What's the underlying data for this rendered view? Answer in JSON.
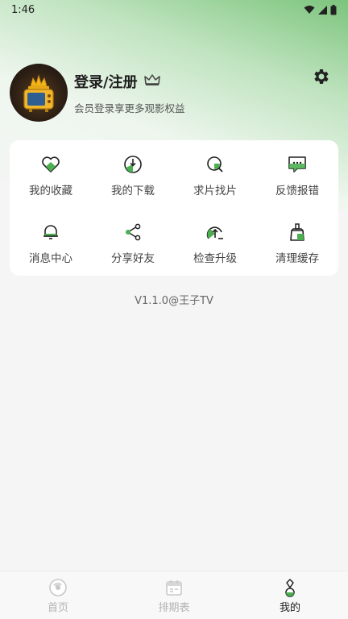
{
  "status_bar": {
    "time": "1:46"
  },
  "profile": {
    "login_label": "登录/注册",
    "member_subtitle": "会员登录享更多观影权益"
  },
  "grid": [
    {
      "label": "我的收藏",
      "icon": "heart-icon"
    },
    {
      "label": "我的下载",
      "icon": "download-icon"
    },
    {
      "label": "求片找片",
      "icon": "search-film-icon"
    },
    {
      "label": "反馈报错",
      "icon": "feedback-icon"
    },
    {
      "label": "消息中心",
      "icon": "bell-icon"
    },
    {
      "label": "分享好友",
      "icon": "share-icon"
    },
    {
      "label": "检查升级",
      "icon": "upgrade-icon"
    },
    {
      "label": "清理缓存",
      "icon": "clean-cache-icon"
    }
  ],
  "version": "V1.1.0@王子TV",
  "bottom_nav": [
    {
      "label": "首页",
      "icon": "home-icon",
      "active": false
    },
    {
      "label": "排期表",
      "icon": "calendar-icon",
      "active": false
    },
    {
      "label": "我的",
      "icon": "profile-icon",
      "active": true
    }
  ],
  "colors": {
    "accent": "#4caf50",
    "accent_dark": "#2e7d32",
    "card_bg": "#ffffff"
  }
}
